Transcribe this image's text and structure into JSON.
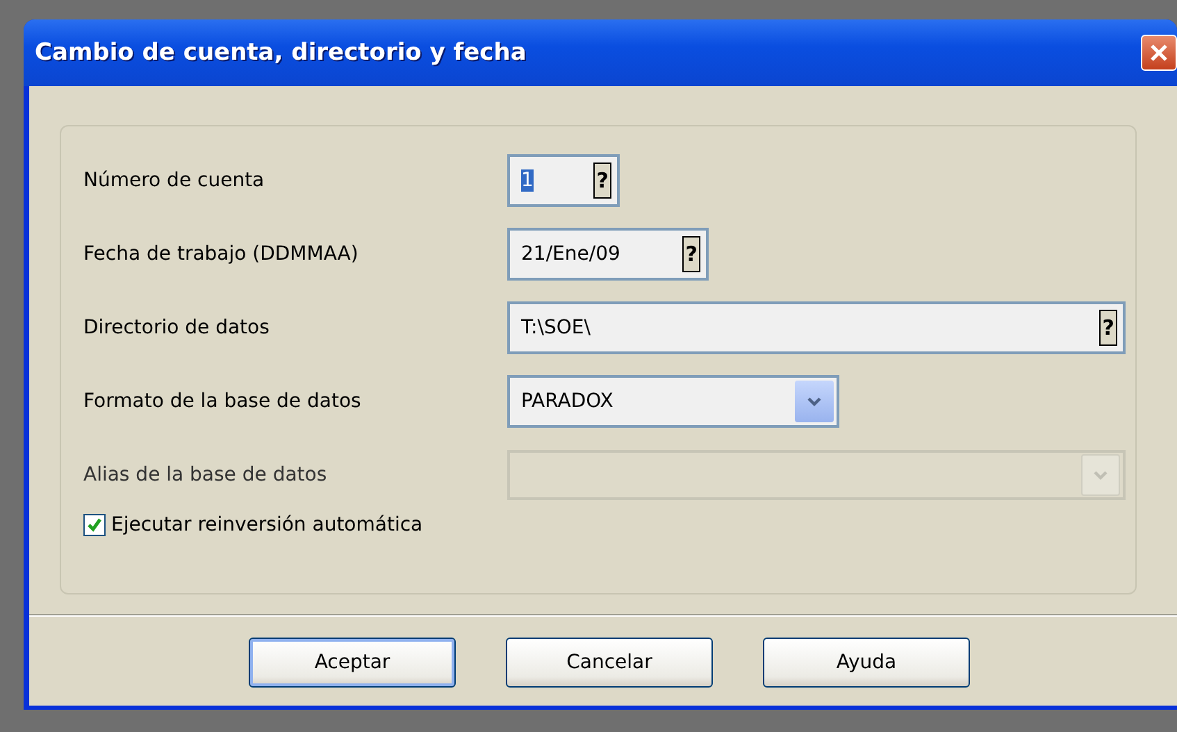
{
  "window": {
    "title": "Cambio de cuenta, directorio y fecha"
  },
  "fields": [
    {
      "kind": "lookup",
      "label": "Número de cuenta",
      "value": "1",
      "value_selected": true,
      "help": "?"
    },
    {
      "kind": "lookup",
      "label": "Fecha de trabajo (DDMMAA)",
      "value": "21/Ene/09",
      "value_selected": false,
      "help": "?"
    },
    {
      "kind": "lookup",
      "label": "Directorio de datos",
      "value": "T:\\SOE\\",
      "value_selected": false,
      "help": "?"
    },
    {
      "kind": "dropdown",
      "label": "Formato de la base de datos",
      "value": "PARADOX",
      "disabled": false
    },
    {
      "kind": "dropdown",
      "label": "Alias de la base de datos",
      "disabled": true
    }
  ],
  "checkbox": {
    "label": "Ejecutar reinversión automática",
    "checked": true
  },
  "buttons": [
    {
      "label": "Aceptar",
      "default": true
    },
    {
      "label": "Cancelar",
      "default": false
    },
    {
      "label": "Ayuda",
      "default": false
    }
  ]
}
